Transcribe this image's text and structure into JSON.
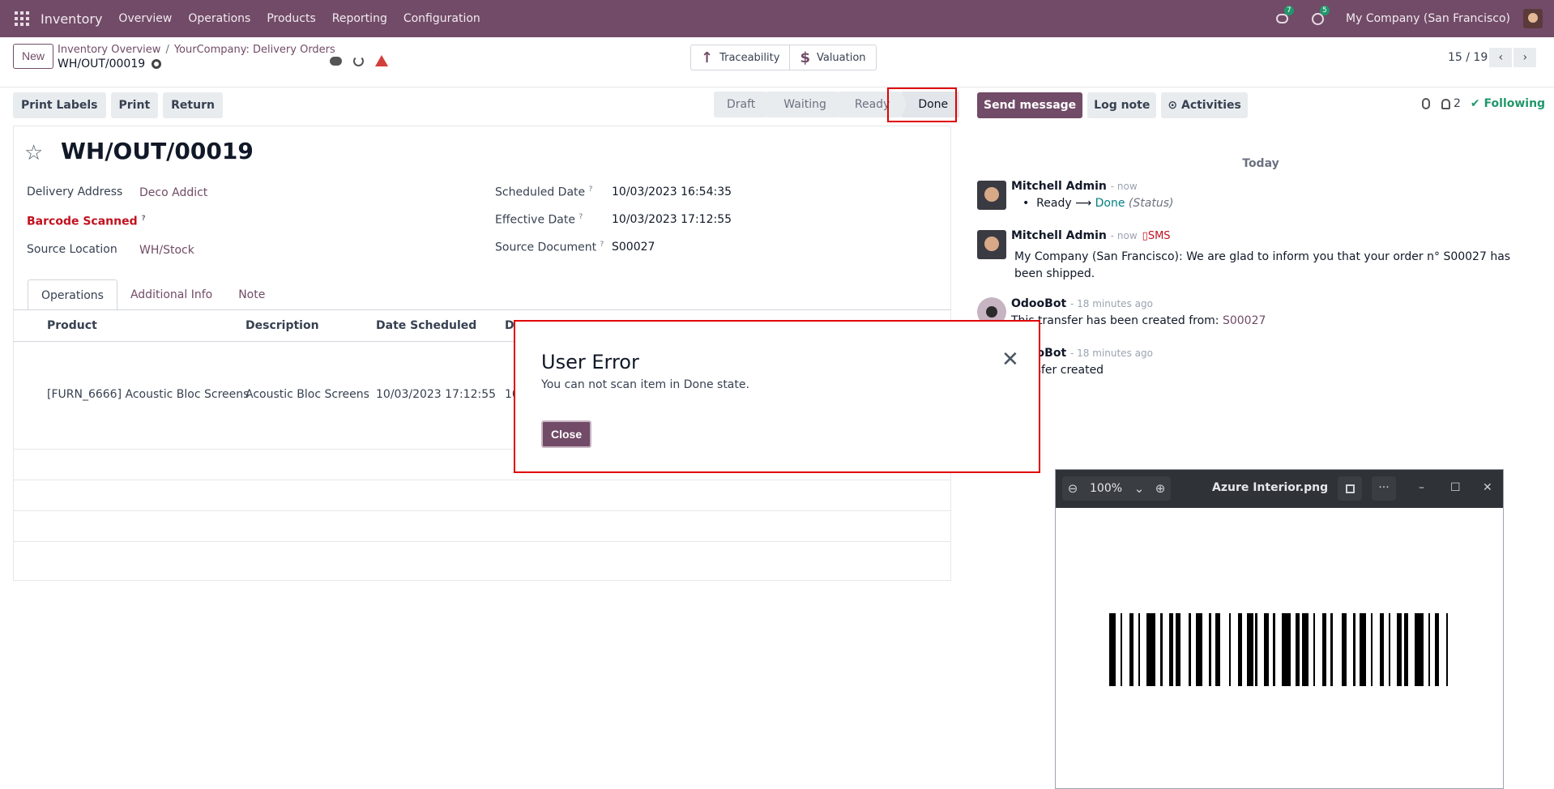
{
  "nav": {
    "brand": "Inventory",
    "menu": [
      "Overview",
      "Operations",
      "Products",
      "Reporting",
      "Configuration"
    ],
    "messages_count": "7",
    "activities_count": "5",
    "company": "My Company (San Francisco)"
  },
  "control": {
    "new_label": "New",
    "breadcrumb_1": "Inventory Overview",
    "breadcrumb_sep": "/",
    "breadcrumb_2": "YourCompany: Delivery Orders",
    "record_name": "WH/OUT/00019",
    "traceability": "Traceability",
    "valuation": "Valuation",
    "pager": "15 / 19"
  },
  "actions": [
    "Print Labels",
    "Print",
    "Return"
  ],
  "stages": [
    "Draft",
    "Waiting",
    "Ready",
    "Done"
  ],
  "chatter_actions": {
    "send_message": "Send message",
    "log_note": "Log note",
    "activities": "Activities",
    "followers_count": "2",
    "following": "Following"
  },
  "form": {
    "title": "WH/OUT/00019",
    "delivery_address_label": "Delivery Address",
    "delivery_address": "Deco Addict",
    "barcode_label": "Barcode Scanned",
    "source_location_label": "Source Location",
    "source_location": "WH/Stock",
    "scheduled_date_label": "Scheduled Date",
    "scheduled_date": "10/03/2023 16:54:35",
    "effective_date_label": "Effective Date",
    "effective_date": "10/03/2023 17:12:55",
    "source_document_label": "Source Document",
    "source_document": "S00027",
    "help_mark": "?"
  },
  "tabs": [
    "Operations",
    "Additional Info",
    "Note"
  ],
  "table": {
    "headers": [
      "Product",
      "Description",
      "Date Scheduled",
      "D"
    ],
    "rows": [
      [
        "[FURN_6666] Acoustic Bloc Screens",
        "Acoustic Bloc Screens",
        "10/03/2023 17:12:55",
        "10"
      ]
    ]
  },
  "chatter": {
    "today": "Today",
    "messages": [
      {
        "author": "Mitchell Admin",
        "time": "- now",
        "old": "Ready",
        "arrow": "⟶",
        "new": "Done",
        "field": "(Status)"
      },
      {
        "author": "Mitchell Admin",
        "time": "- now",
        "tag": "SMS",
        "body": "My Company (San Francisco): We are glad to inform you that your order n° S00027 has been shipped."
      },
      {
        "author": "OdooBot",
        "time": "- 18 minutes ago",
        "body": "This transfer has been created from:",
        "link": "S00027"
      },
      {
        "author": "OdooBot",
        "time": "- 18 minutes ago",
        "body": "Transfer created"
      }
    ]
  },
  "modal": {
    "title": "User Error",
    "message": "You can not scan item in Done state.",
    "close_label": "Close"
  },
  "viewer": {
    "zoom": "100%",
    "title": "Azure Interior.png"
  }
}
